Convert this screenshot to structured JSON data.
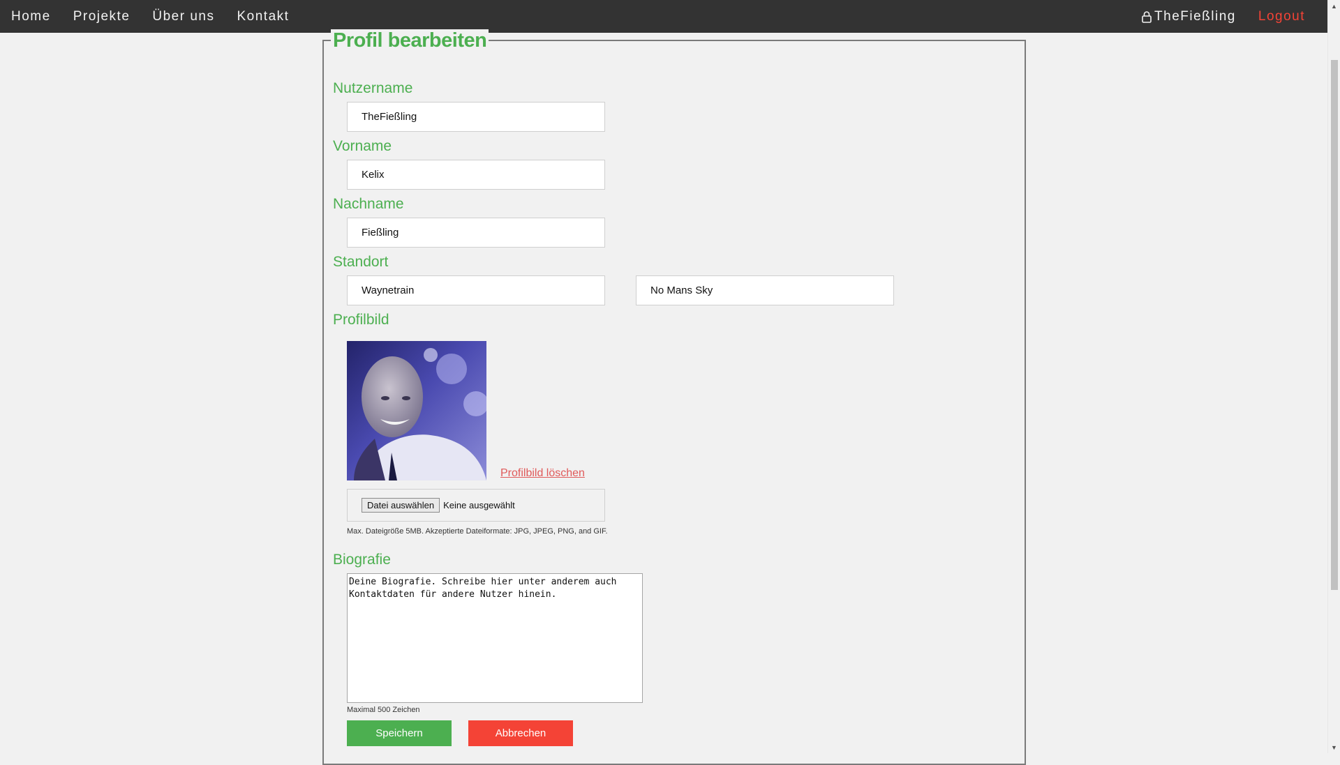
{
  "nav": {
    "items": [
      "Home",
      "Projekte",
      "Über uns",
      "Kontakt"
    ],
    "user": "TheFießling",
    "logout": "Logout"
  },
  "form": {
    "legend": "Profil bearbeiten",
    "username_label": "Nutzername",
    "username_value": "TheFießling",
    "firstname_label": "Vorname",
    "firstname_value": "Kelix",
    "lastname_label": "Nachname",
    "lastname_value": "Fießling",
    "location_label": "Standort",
    "location_city": "Waynetrain",
    "location_country": "No Mans Sky",
    "picture_label": "Profilbild",
    "delete_picture": "Profilbild löschen",
    "file_button": "Datei auswählen",
    "file_status": "Keine ausgewählt",
    "file_hint": "Max. Dateigröße 5MB. Akzeptierte Dateiformate: JPG, JPEG, PNG, and GIF.",
    "bio_label": "Biografie",
    "bio_value": "Deine Biografie. Schreibe hier unter anderem auch\nKontaktdaten für andere Nutzer hinein.",
    "bio_hint": "Maximal 500 Zeichen",
    "save": "Speichern",
    "cancel": "Abbrechen"
  },
  "colors": {
    "accent": "#4caf50",
    "danger": "#f44336",
    "nav_bg": "#333333"
  }
}
